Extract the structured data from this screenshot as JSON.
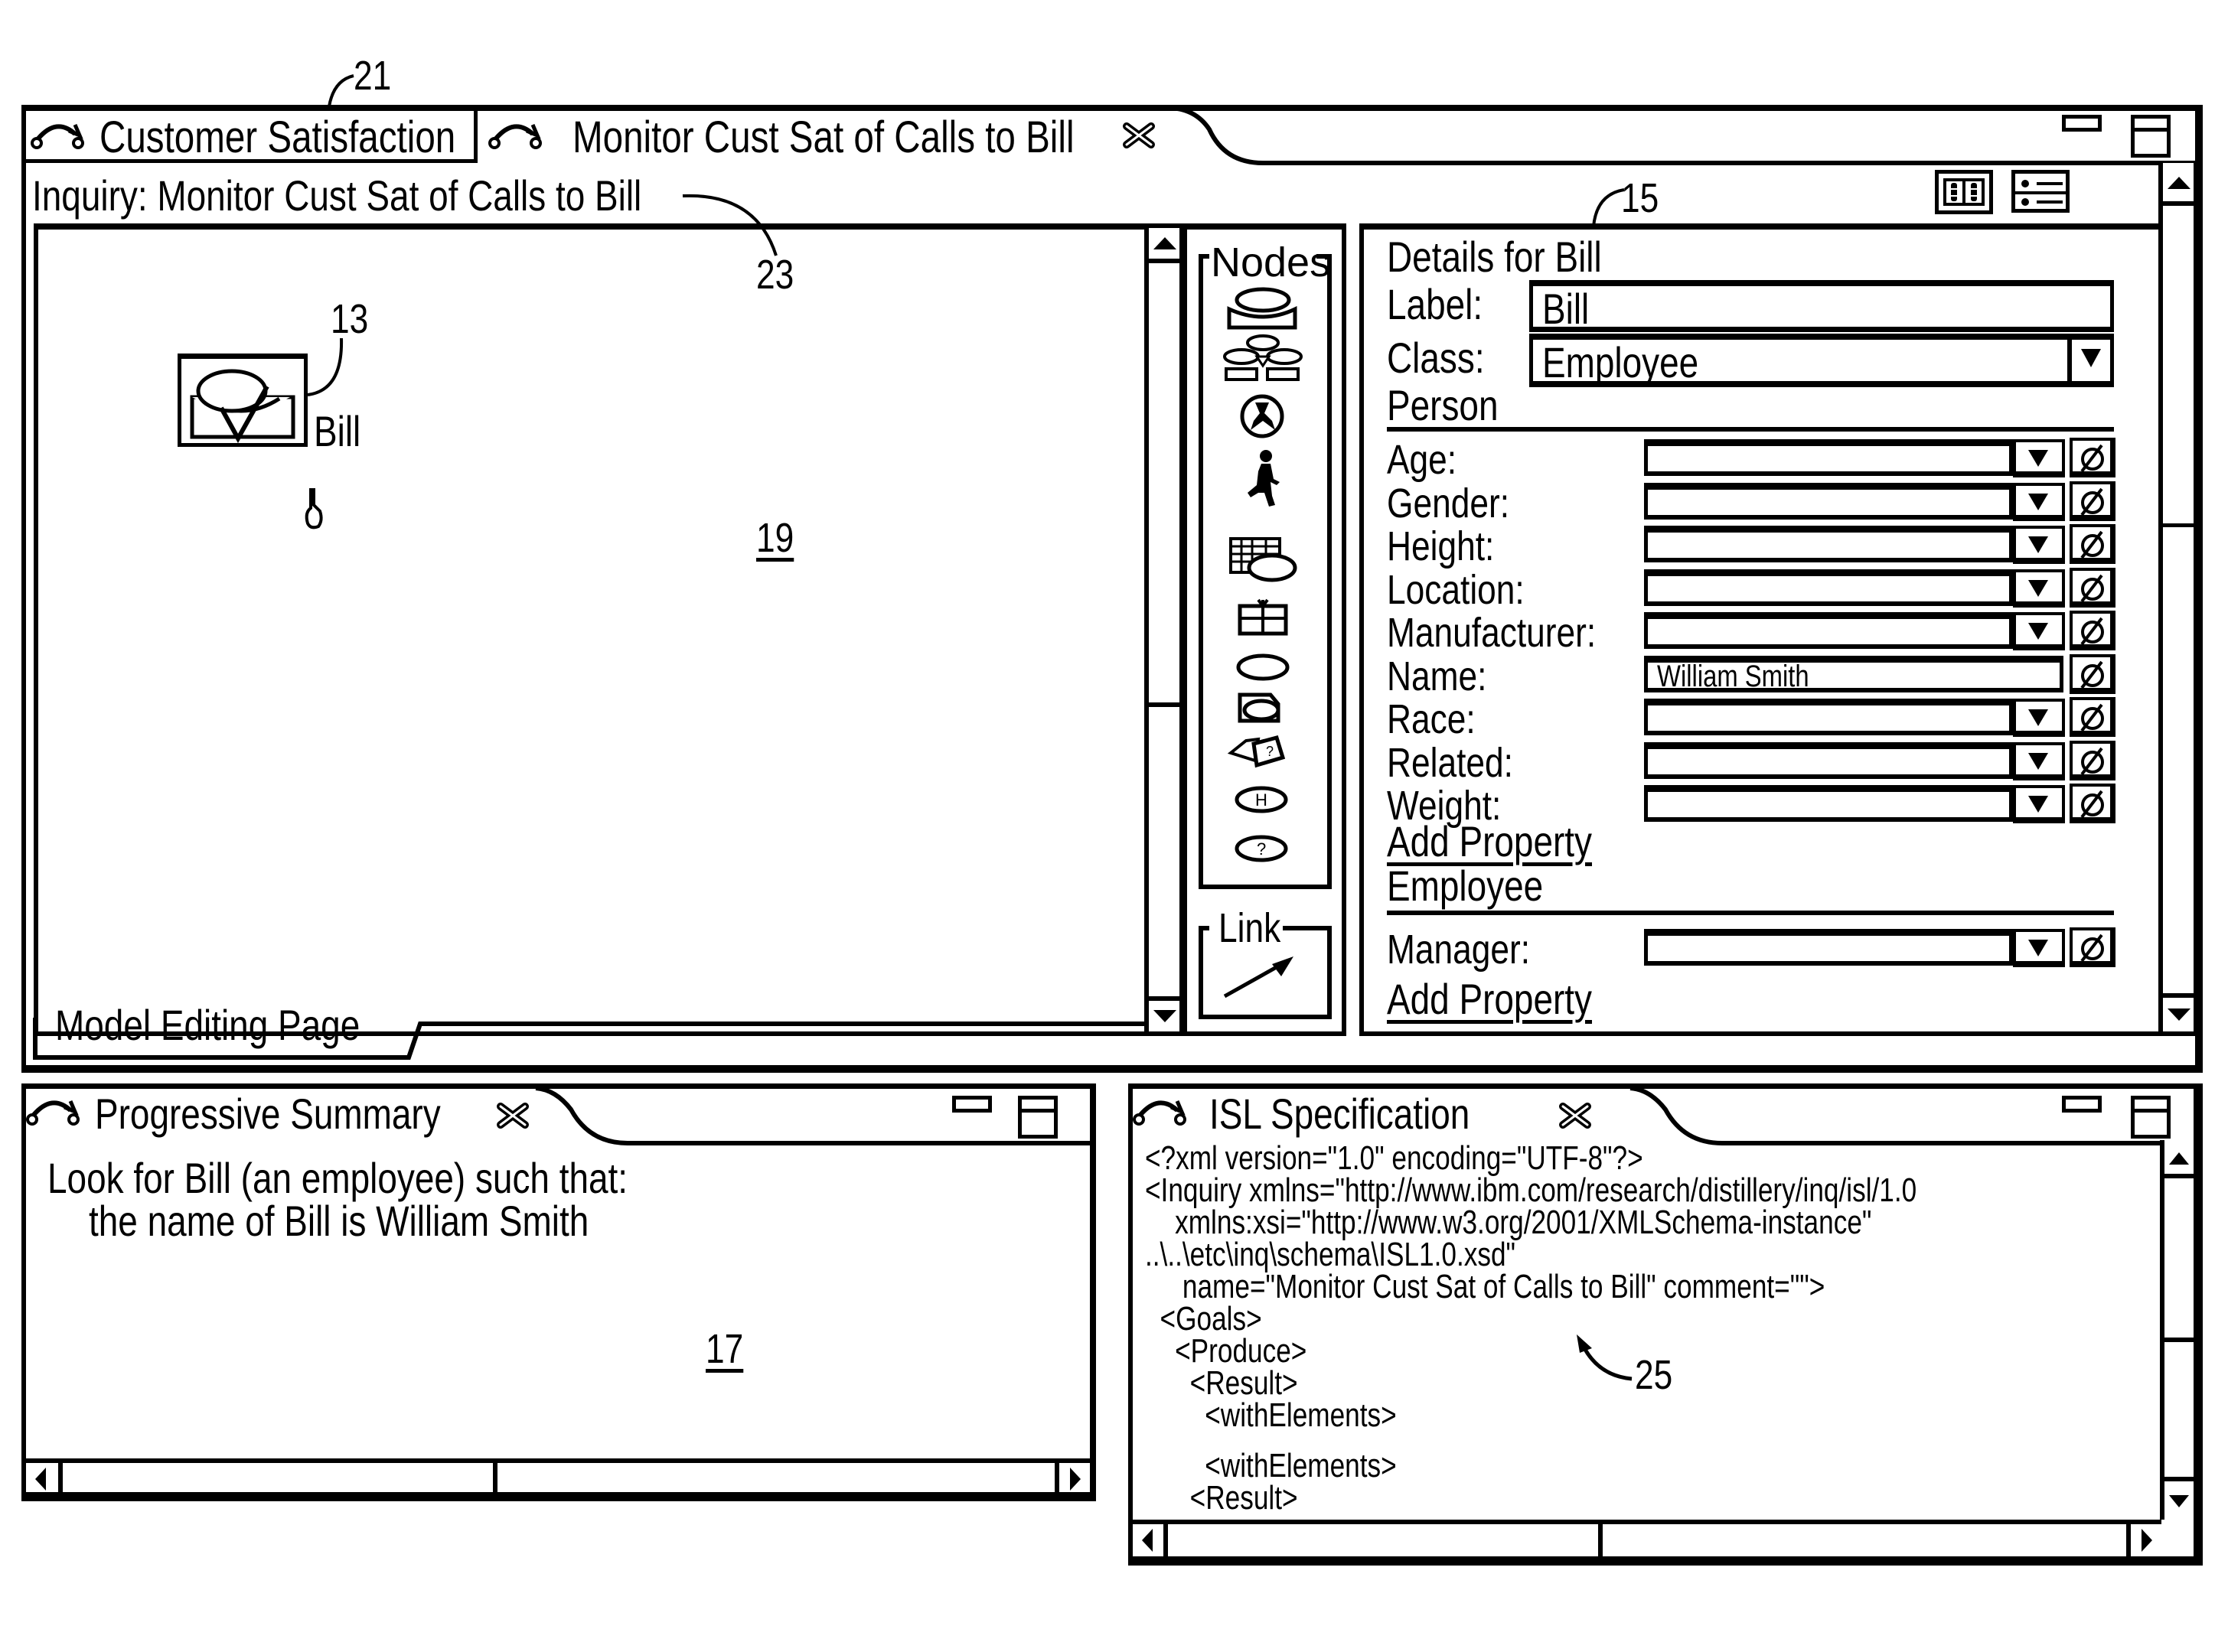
{
  "reference_numerals": {
    "workspace": "21",
    "inquiry_title": "23",
    "node": "13",
    "canvas": "19",
    "details": "15",
    "summary": "17",
    "isl": "25"
  },
  "main_window": {
    "tabs": [
      {
        "label": "Customer Satisfaction",
        "icon": "curved-arrow-icon",
        "active": false
      },
      {
        "label": "Monitor Cust Sat of Calls to Bill",
        "icon": "curved-arrow-icon",
        "active": true,
        "closable": true
      }
    ],
    "window_buttons": [
      "minimize-icon",
      "maximize-icon"
    ],
    "inquiry_label": "Inquiry: Monitor Cust Sat of Calls to Bill",
    "view_buttons": [
      "two-column-view-icon",
      "list-view-icon"
    ],
    "editor_tab_label": "Model Editing Page"
  },
  "canvas": {
    "nodes": [
      {
        "label": "Bill",
        "icon": "person-node-icon",
        "selected": true
      }
    ],
    "cursor": "hand-pointer-icon"
  },
  "palette": {
    "nodes_title": "Nodes",
    "node_tools": [
      "entity-node-icon",
      "group-node-icon",
      "event-node-icon",
      "action-node-icon",
      "table-node-icon",
      "package-node-icon",
      "ellipse-node-icon",
      "document-node-icon",
      "unknown-node-icon",
      "h-node-icon",
      "question-node-icon"
    ],
    "node_tool_glyphs": {
      "h": "H",
      "q": "?"
    },
    "link_title": "Link",
    "link_tool": "arrow-link-icon"
  },
  "details": {
    "title": "Details for Bill",
    "label_caption": "Label:",
    "label_value": "Bill",
    "class_caption": "Class:",
    "class_value": "Employee",
    "sections": [
      {
        "name": "Person",
        "properties": [
          {
            "label": "Age:",
            "value": "",
            "type": "dropdown"
          },
          {
            "label": "Gender:",
            "value": "",
            "type": "dropdown"
          },
          {
            "label": "Height:",
            "value": "",
            "type": "dropdown"
          },
          {
            "label": "Location:",
            "value": "",
            "type": "dropdown"
          },
          {
            "label": "Manufacturer:",
            "value": "",
            "type": "dropdown"
          },
          {
            "label": "Name:",
            "value": "William Smith",
            "type": "text"
          },
          {
            "label": "Race:",
            "value": "",
            "type": "dropdown"
          },
          {
            "label": "Related:",
            "value": "",
            "type": "dropdown"
          },
          {
            "label": "Weight:",
            "value": "",
            "type": "dropdown"
          }
        ],
        "add_label": "Add Property"
      },
      {
        "name": "Employee",
        "properties": [
          {
            "label": "Manager:",
            "value": "",
            "type": "dropdown"
          }
        ],
        "add_label": "Add Property"
      }
    ]
  },
  "summary_panel": {
    "title": "Progressive Summary",
    "lines": [
      "Look for Bill (an employee) such that:",
      "the name of Bill is William Smith"
    ]
  },
  "isl_panel": {
    "title": "ISL Specification",
    "lines": [
      "<?xml version=\"1.0\" encoding=\"UTF-8\"?>",
      "<Inquiry xmlns=\"http://www.ibm.com/research/distillery/inq/isl/1.0",
      "    xmlns:xsi=\"http://www.w3.org/2001/XMLSchema-instance\"",
      "..\\..\\etc\\inq\\schema\\ISL1.0.xsd\"",
      "     name=\"Monitor Cust Sat of Calls to Bill\" comment=\"\">",
      "  <Goals>",
      "    <Produce>",
      "      <Result>",
      "        <withElements>",
      "",
      "        <withElements>",
      "      <Result>"
    ]
  }
}
